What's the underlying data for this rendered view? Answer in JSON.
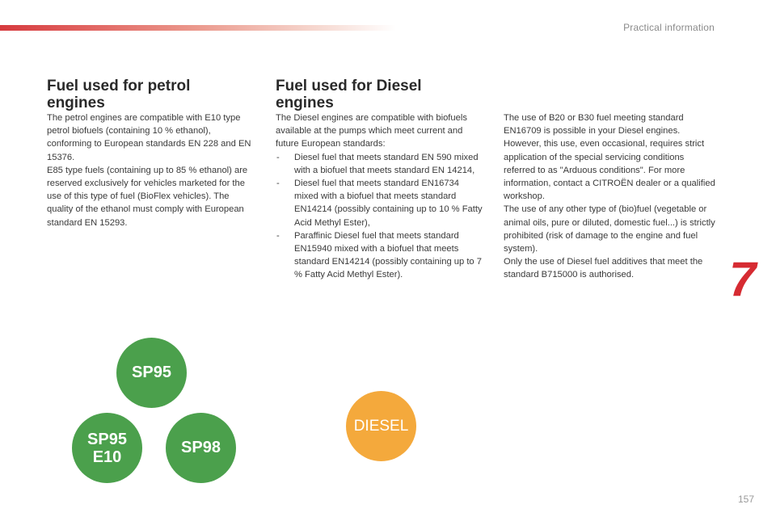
{
  "header": {
    "section_label": "Practical information",
    "accent_color": "#d63a3e"
  },
  "petrol": {
    "heading": "Fuel used for petrol engines",
    "paragraphs": [
      "The petrol engines are compatible with E10 type petrol biofuels (containing 10 % ethanol), conforming to European standards EN 228 and EN 15376.",
      "E85 type fuels (containing up to 85 % ethanol) are reserved exclusively for vehicles marketed for the use of this type of fuel (BioFlex vehicles). The quality of the ethanol must comply with European standard EN 15293."
    ]
  },
  "diesel": {
    "heading": "Fuel used for Diesel engines",
    "intro": "The Diesel engines are compatible with biofuels available at the pumps which meet current and future European standards:",
    "items": [
      "Diesel fuel that meets standard EN 590 mixed with a biofuel that meets standard EN 14214,",
      "Diesel fuel that meets standard EN16734 mixed with a biofuel that meets standard EN14214 (possibly containing up to 10 % Fatty Acid Methyl Ester),",
      "Paraffinic Diesel fuel that meets standard EN15940 mixed with a biofuel that meets standard EN14214 (possibly containing up to 7 % Fatty Acid Methyl Ester)."
    ]
  },
  "diesel_notes": {
    "paragraphs": [
      "The use of B20 or B30 fuel meeting standard EN16709 is possible in your Diesel engines. However, this use, even occasional, requires strict application of the special servicing conditions referred to as \"Arduous conditions\". For more information, contact a CITROËN dealer or a qualified workshop.",
      "The use of any other type of (bio)fuel (vegetable or animal oils, pure or diluted, domestic fuel...) is strictly prohibited (risk of damage to the engine and fuel system).",
      "Only the use of Diesel fuel additives that meet the standard B715000 is authorised."
    ]
  },
  "fuel_badges": {
    "sp95": "SP95",
    "sp95_e10": "SP95\nE10",
    "sp98": "SP98",
    "diesel": "DIESEL",
    "green_color": "#4ba04c",
    "orange_color": "#f4a93c"
  },
  "chapter": {
    "number": "7",
    "color": "#d62b32"
  },
  "footer": {
    "page_number": "157"
  }
}
